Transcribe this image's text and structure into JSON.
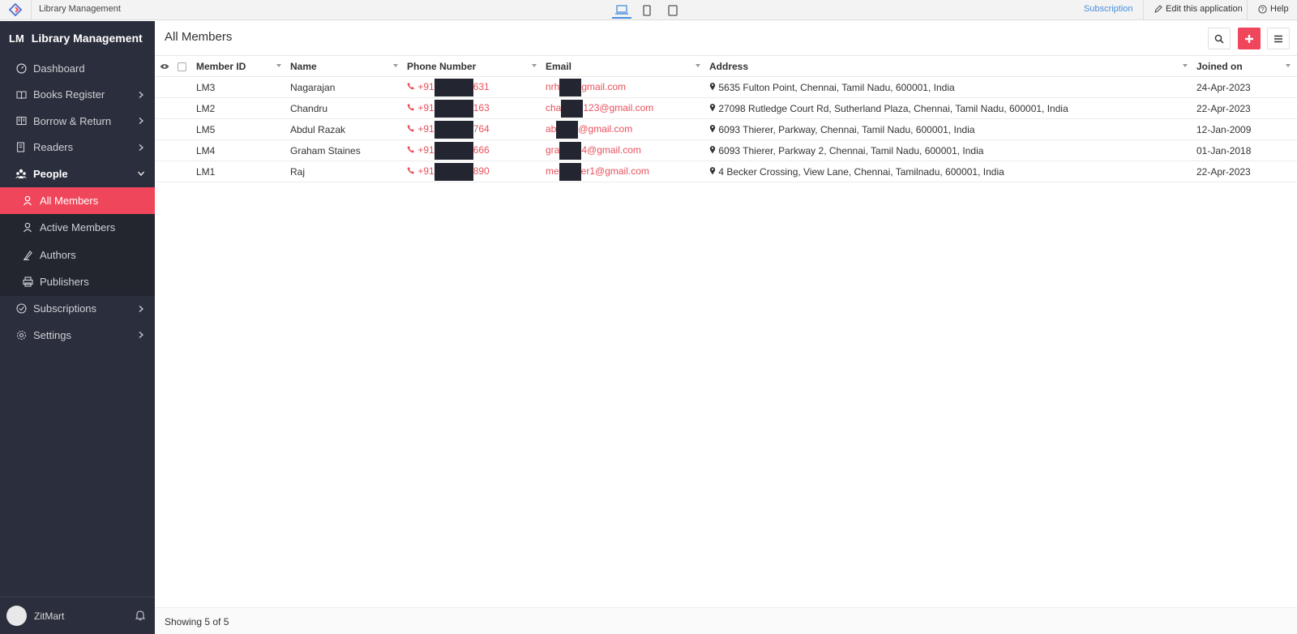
{
  "topbar": {
    "app_name": "Library Management",
    "subscription": "Subscription",
    "edit_app": "Edit this application",
    "help": "Help"
  },
  "sidebar": {
    "brand_abbr": "LM",
    "brand_title": "Library Management",
    "items": [
      {
        "label": "Dashboard",
        "icon": "dashboard-icon"
      },
      {
        "label": "Books Register",
        "icon": "book-icon"
      },
      {
        "label": "Borrow & Return",
        "icon": "borrow-icon"
      },
      {
        "label": "Readers",
        "icon": "readers-icon"
      },
      {
        "label": "People",
        "icon": "people-icon"
      },
      {
        "label": "Subscriptions",
        "icon": "subscriptions-icon"
      },
      {
        "label": "Settings",
        "icon": "gear-icon"
      }
    ],
    "people_sub": [
      {
        "label": "All Members"
      },
      {
        "label": "Active Members"
      },
      {
        "label": "Authors"
      },
      {
        "label": "Publishers"
      }
    ],
    "user": "ZitMart"
  },
  "main": {
    "title": "All Members",
    "columns": [
      "Member ID",
      "Name",
      "Phone Number",
      "Email",
      "Address",
      "Joined on"
    ],
    "rows": [
      {
        "id": "LM3",
        "name": "Nagarajan",
        "phone_a": "+91",
        "phone_b": "631",
        "email_a": "nrh",
        "email_b": "gmail.com",
        "address": "5635 Fulton Point, Chennai, Tamil Nadu, 600001, India",
        "joined": "24-Apr-2023"
      },
      {
        "id": "LM2",
        "name": "Chandru",
        "phone_a": "+91",
        "phone_b": "163",
        "email_a": "cha",
        "email_b": "123@gmail.com",
        "address": "27098 Rutledge Court Rd, Sutherland Plaza, Chennai, Tamil Nadu, 600001, India",
        "joined": "22-Apr-2023"
      },
      {
        "id": "LM5",
        "name": "Abdul Razak",
        "phone_a": "+91",
        "phone_b": "764",
        "email_a": "ab",
        "email_b": "@gmail.com",
        "address": "6093 Thierer, Parkway, Chennai, Tamil Nadu, 600001, India",
        "joined": "12-Jan-2009"
      },
      {
        "id": "LM4",
        "name": "Graham Staines",
        "phone_a": "+91",
        "phone_b": "666",
        "email_a": "gra",
        "email_b": "4@gmail.com",
        "address": "6093 Thierer, Parkway 2, Chennai, Tamil Nadu, 600001, India",
        "joined": "01-Jan-2018"
      },
      {
        "id": "LM1",
        "name": "Raj",
        "phone_a": "+91",
        "phone_b": "890",
        "email_a": "me",
        "email_b": "er1@gmail.com",
        "address": "4 Becker Crossing, View Lane, Chennai, Tamilnadu, 600001, India",
        "joined": "22-Apr-2023"
      }
    ],
    "showing": "Showing 5 of 5"
  }
}
